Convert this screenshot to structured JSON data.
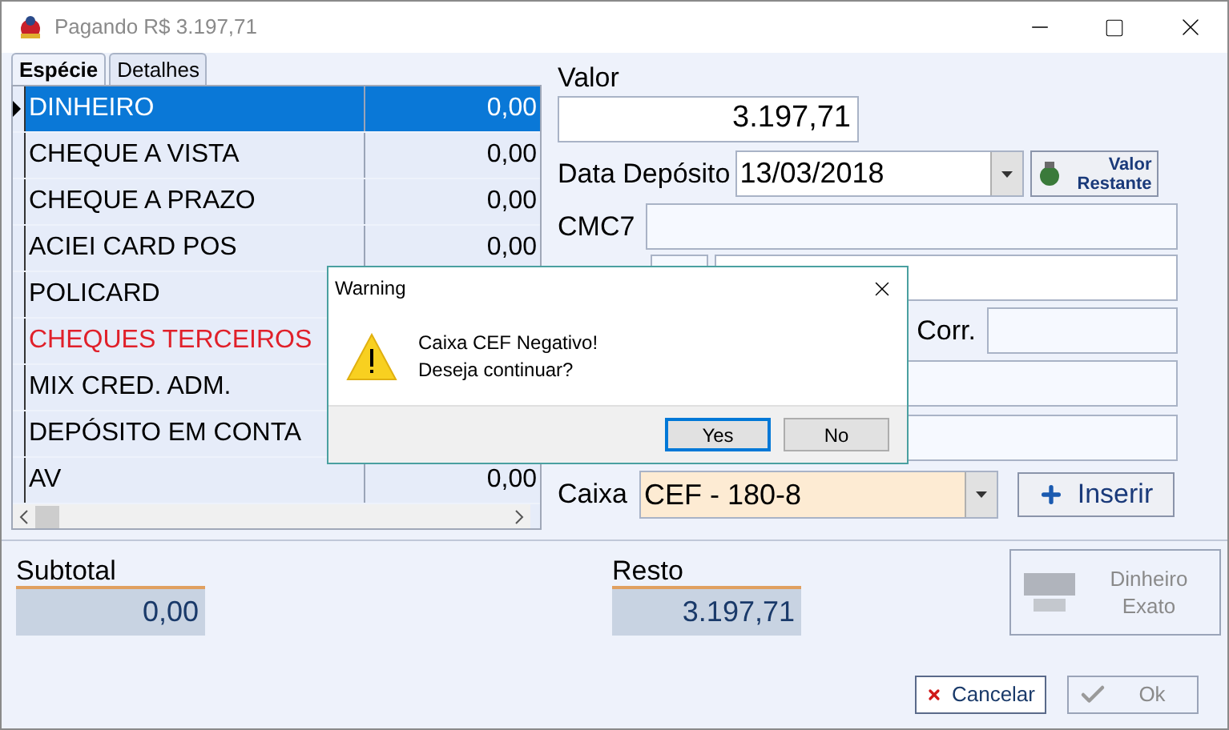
{
  "window": {
    "title": "Pagando R$ 3.197,71"
  },
  "tabs": [
    {
      "label": "Espécie",
      "selected": true
    },
    {
      "label": "Detalhes",
      "selected": false
    }
  ],
  "grid": {
    "rows": [
      {
        "name": "DINHEIRO",
        "value": "0,00",
        "selected": true,
        "color": "#ffffff"
      },
      {
        "name": "CHEQUE A VISTA",
        "value": "0,00",
        "selected": false,
        "color": "#000000"
      },
      {
        "name": "CHEQUE A PRAZO",
        "value": "0,00",
        "selected": false,
        "color": "#000000"
      },
      {
        "name": "ACIEI CARD POS",
        "value": "0,00",
        "selected": false,
        "color": "#000000"
      },
      {
        "name": "POLICARD",
        "selected": false,
        "color": "#000000"
      },
      {
        "name": "CHEQUES TERCEIROS",
        "selected": false,
        "color": "#e0202a"
      },
      {
        "name": "MIX CRED. ADM.",
        "selected": false,
        "color": "#000000"
      },
      {
        "name": "DEPÓSITO EM CONTA",
        "selected": false,
        "color": "#000000"
      },
      {
        "name": "AV",
        "value": "0,00",
        "selected": false,
        "color": "#000000"
      }
    ]
  },
  "valor": {
    "label": "Valor",
    "value": "3.197,71"
  },
  "data_deposito": {
    "label": "Data Depósito",
    "value": "13/03/2018"
  },
  "valor_restante_button": {
    "lines": [
      "Valor",
      "Restante"
    ]
  },
  "cmc7": {
    "label": "CMC7"
  },
  "corr": {
    "label": "Corr."
  },
  "caixa": {
    "label": "Caixa",
    "value": "CEF - 180-8"
  },
  "inserir_button": {
    "label": "Inserir"
  },
  "subtotal": {
    "label": "Subtotal",
    "value": "0,00"
  },
  "resto": {
    "label": "Resto",
    "value": "3.197,71"
  },
  "exact_cash_button": {
    "lines": [
      "Dinheiro",
      "Exato"
    ],
    "disabled": true
  },
  "buttons": [
    {
      "kind": "cancel",
      "label": "Cancelar",
      "disabled": false
    },
    {
      "kind": "ok",
      "label": "Ok",
      "disabled": true
    }
  ],
  "dialog": {
    "title": "Warning",
    "message": [
      "Caixa CEF Negativo!",
      "Deseja continuar?"
    ],
    "buttons": [
      {
        "label": "Yes",
        "selected": true
      },
      {
        "label": "No",
        "selected": false
      }
    ]
  }
}
